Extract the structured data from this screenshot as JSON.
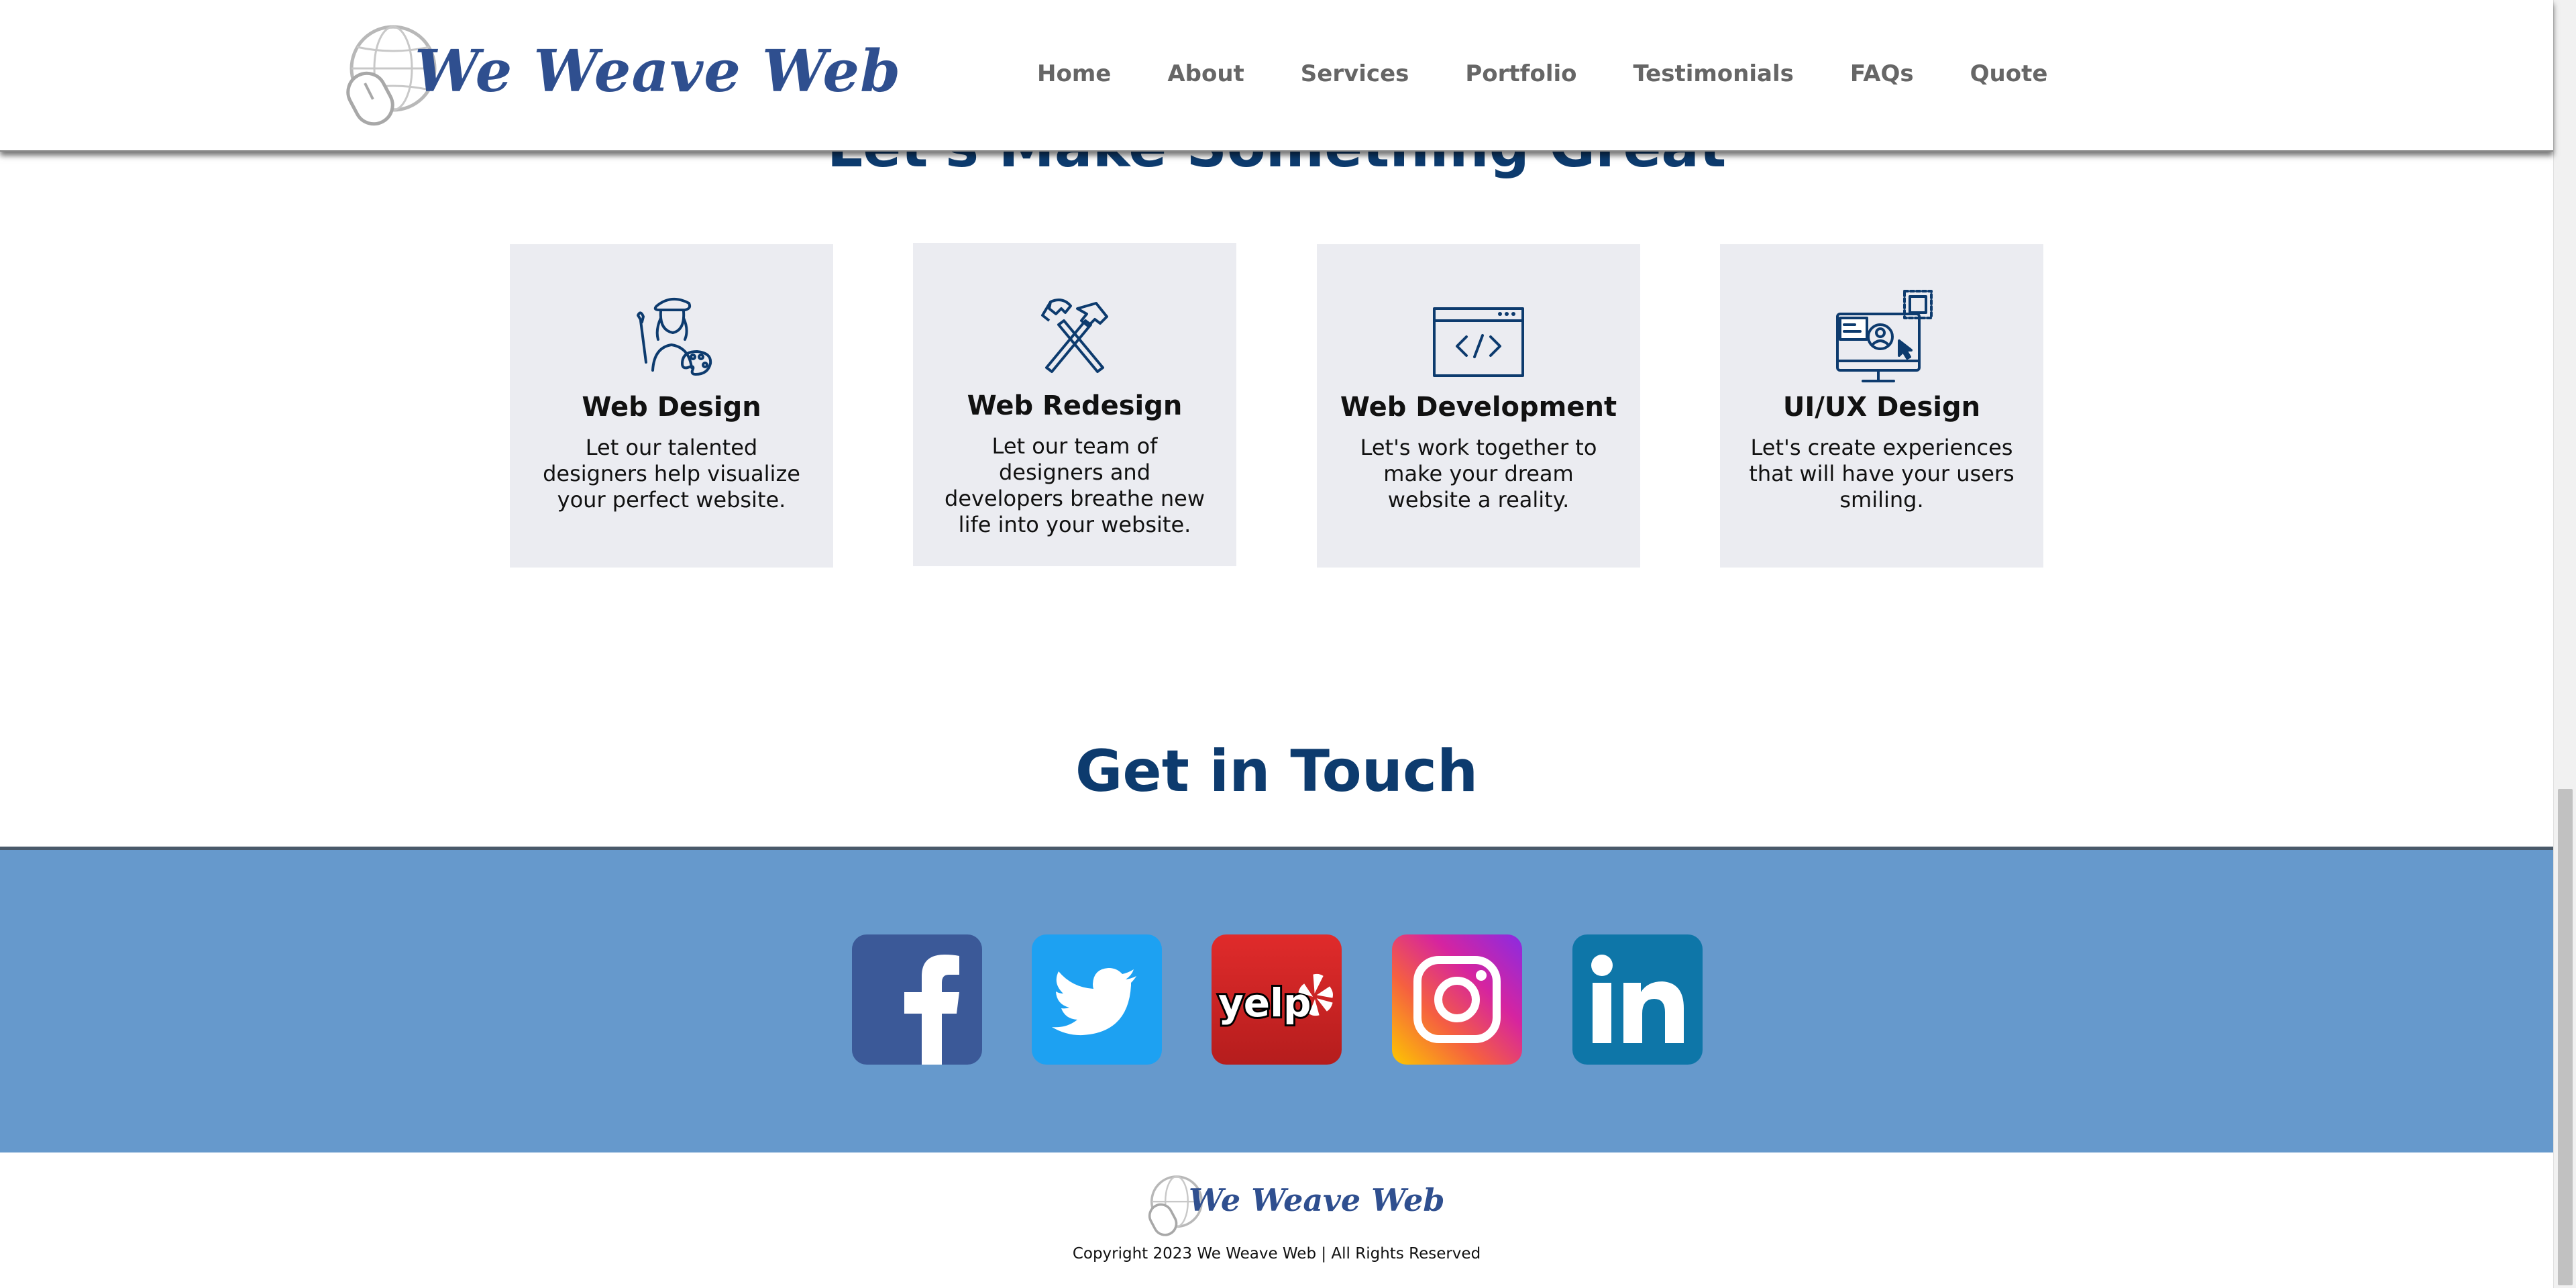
{
  "header": {
    "logo_text": "We Weave Web",
    "logo_icon": "globe-mouse-icon",
    "nav": [
      "Home",
      "About",
      "Services",
      "Portfolio",
      "Testimonials",
      "FAQs",
      "Quote"
    ]
  },
  "services": {
    "title": "Let's Make Something Great",
    "cards": [
      {
        "icon": "artist-icon",
        "title": "Web Design",
        "desc": "Let our talented designers help visualize your perfect website."
      },
      {
        "icon": "hammers-icon",
        "title": "Web Redesign",
        "desc": "Let our team of designers and developers breathe new life into your website."
      },
      {
        "icon": "code-window-icon",
        "title": "Web Development",
        "desc": "Let's work together to make your dream website a reality."
      },
      {
        "icon": "ui-monitor-icon",
        "title": "UI/UX Design",
        "desc": "Let's create experiences that will have your users smiling."
      }
    ]
  },
  "contact": {
    "title": "Get in Touch",
    "social": [
      {
        "name": "facebook",
        "icon": "facebook-icon",
        "color": "#3b5998"
      },
      {
        "name": "twitter",
        "icon": "twitter-icon",
        "color": "#1da1f2"
      },
      {
        "name": "yelp",
        "icon": "yelp-icon",
        "color": "#d32323"
      },
      {
        "name": "instagram",
        "icon": "instagram-icon",
        "color": "#c13584"
      },
      {
        "name": "linkedin",
        "icon": "linkedin-icon",
        "color": "#0e76a8"
      }
    ]
  },
  "footer": {
    "logo_text": "We Weave Web",
    "copyright": "Copyright 2023 We Weave Web | All Rights Reserved"
  },
  "colors": {
    "brand_blue": "#2f4f8f",
    "heading_navy": "#0d3b6e",
    "social_band": "#6699cc",
    "card_bg": "#ebecf1"
  }
}
